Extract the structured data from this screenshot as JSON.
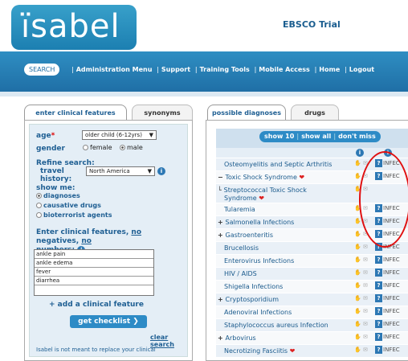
{
  "header": {
    "logo": "ïsabel",
    "trial": "EBSCO Trial"
  },
  "nav": {
    "search": "SEARCH",
    "links": [
      "Administration Menu",
      "Support",
      "Training Tools",
      "Mobile Access",
      "Home",
      "Logout"
    ]
  },
  "left_tabs": {
    "features": "enter clinical features",
    "synonyms": "synonyms"
  },
  "form": {
    "age_label": "age",
    "age_required": "*",
    "age_value": "older child (6-12yrs)",
    "gender_label": "gender",
    "female": "female",
    "male": "male",
    "refine": "Refine search:",
    "travel_label": "travel history:",
    "travel_value": "North America",
    "show_me": "show me:",
    "options": [
      "diagnoses",
      "causative drugs",
      "bioterrorist agents"
    ],
    "features_label_1": "Enter clinical features,",
    "features_no": "no",
    "features_label_2": "negatives,",
    "features_no2": "no",
    "features_label_3": "numbers:",
    "features": [
      "ankle pain",
      "ankle edema",
      "fever",
      "diarrhea",
      ""
    ],
    "add_feature": "+ add a clinical feature",
    "checklist": "get checklist",
    "clear": "clear search",
    "disclaimer": "Isabel is not meant to replace your clinical"
  },
  "right_tabs": {
    "possible": "possible diagnoses",
    "drugs": "drugs"
  },
  "results": {
    "show10": "show 10",
    "show_all": "show all",
    "dont_miss": "don't miss",
    "rows": [
      {
        "name": "Osteomyelitis and Septic Arthritis",
        "prefix": "",
        "tag": "INFEC"
      },
      {
        "name": "Toxic Shock Syndrome",
        "prefix": "−",
        "tag": "INFEC",
        "flag": true
      },
      {
        "name": "Streptococcal Toxic Shock",
        "name2": "Syndrome",
        "prefix": "└",
        "tag": "",
        "flag": true
      },
      {
        "name": "Tularemia",
        "prefix": "",
        "tag": "INFEC"
      },
      {
        "name": "Salmonella Infections",
        "prefix": "+",
        "tag": "INFEC"
      },
      {
        "name": "Gastroenteritis",
        "prefix": "+",
        "tag": "INFEC"
      },
      {
        "name": "Brucellosis",
        "prefix": "",
        "tag": "INFEC"
      },
      {
        "name": "Enterovirus Infections",
        "prefix": "",
        "tag": "INFEC"
      },
      {
        "name": "HIV / AIDS",
        "prefix": "",
        "tag": "INFEC"
      },
      {
        "name": "Shigella Infections",
        "prefix": "",
        "tag": "INFEC"
      },
      {
        "name": "Cryptosporidium",
        "prefix": "+",
        "tag": "INFEC"
      },
      {
        "name": "Adenoviral Infections",
        "prefix": "",
        "tag": "INFEC"
      },
      {
        "name": "Staphylococcus aureus Infection",
        "prefix": "",
        "tag": "INFEC"
      },
      {
        "name": "Arbovirus",
        "prefix": "+",
        "tag": "INFEC"
      },
      {
        "name": "Necrotizing Fasciitis",
        "prefix": "",
        "tag": "INFEC",
        "flag": true
      }
    ]
  }
}
